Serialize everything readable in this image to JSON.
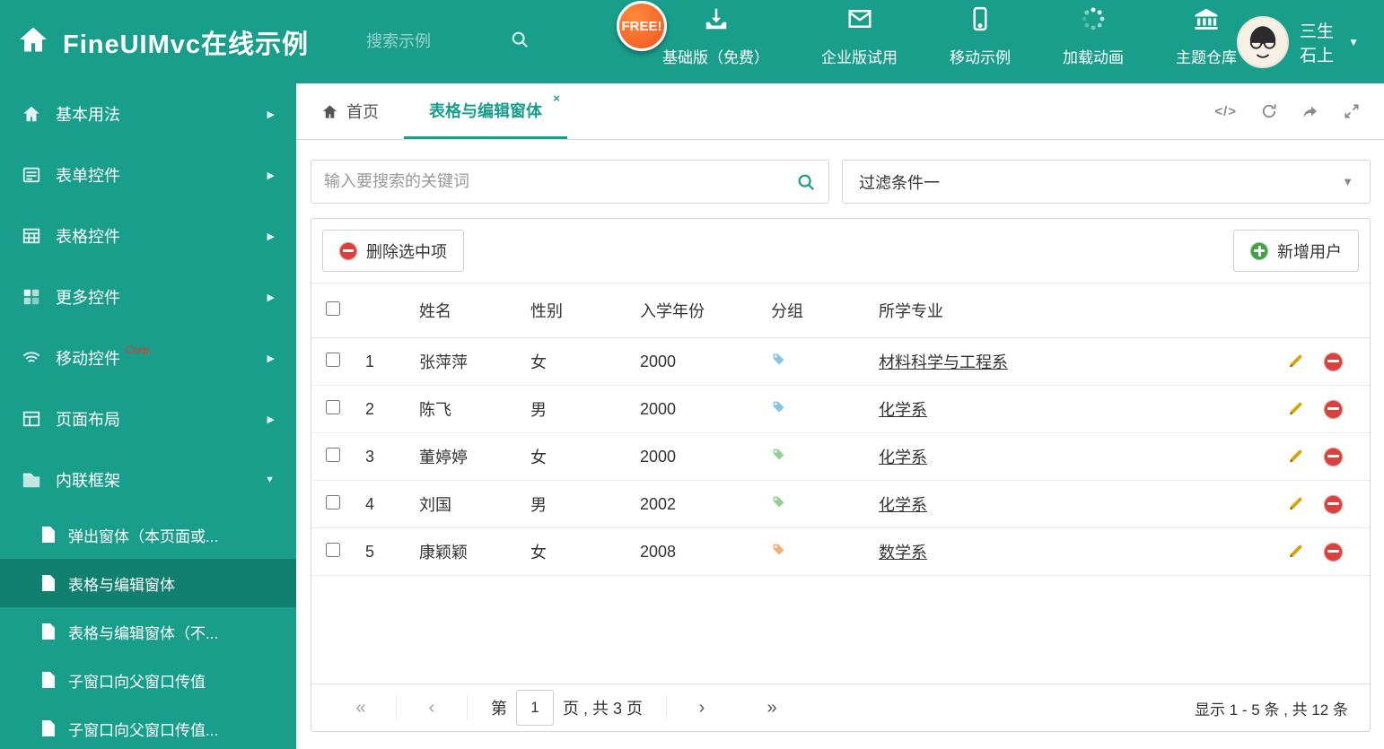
{
  "header": {
    "title": "FineUIMvc在线示例",
    "search_placeholder": "搜索示例",
    "free_badge": "FREE!",
    "nav": [
      {
        "label": "基础版（免费）",
        "icon": "download-icon"
      },
      {
        "label": "企业版试用",
        "icon": "envelope-icon"
      },
      {
        "label": "移动示例",
        "icon": "mobile-icon"
      },
      {
        "label": "加载动画",
        "icon": "spinner-icon"
      },
      {
        "label": "主题仓库",
        "icon": "bank-icon"
      }
    ],
    "user": {
      "name": "三生石上"
    }
  },
  "sidebar": {
    "items": [
      {
        "label": "基本用法",
        "icon": "home-icon"
      },
      {
        "label": "表单控件",
        "icon": "form-icon"
      },
      {
        "label": "表格控件",
        "icon": "table-icon"
      },
      {
        "label": "更多控件",
        "icon": "widgets-icon"
      },
      {
        "label": "移动控件",
        "badge": "Corp.",
        "icon": "mobile-icon"
      },
      {
        "label": "页面布局",
        "icon": "layout-icon"
      },
      {
        "label": "内联框架",
        "icon": "frame-icon",
        "expanded": true
      }
    ],
    "subitems": [
      {
        "label": "弹出窗体（本页面或..."
      },
      {
        "label": "表格与编辑窗体",
        "active": true
      },
      {
        "label": "表格与编辑窗体（不..."
      },
      {
        "label": "子窗口向父窗口传值"
      },
      {
        "label": "子窗口向父窗口传值..."
      }
    ]
  },
  "tabs": [
    {
      "label": "首页",
      "icon": "home-icon"
    },
    {
      "label": "表格与编辑窗体",
      "active": true,
      "closable": true
    }
  ],
  "content": {
    "search_placeholder": "输入要搜索的关键词",
    "filter_value": "过滤条件一",
    "toolbar": {
      "delete_label": "删除选中项",
      "add_label": "新增用户"
    },
    "table": {
      "columns": [
        "姓名",
        "性别",
        "入学年份",
        "分组",
        "所学专业"
      ],
      "rows": [
        {
          "index": 1,
          "name": "张萍萍",
          "gender": "女",
          "year": "2000",
          "tag_color": "#85C3E8",
          "major": "材料科学与工程系"
        },
        {
          "index": 2,
          "name": "陈飞",
          "gender": "男",
          "year": "2000",
          "tag_color": "#85C3E8",
          "major": "化学系"
        },
        {
          "index": 3,
          "name": "董婷婷",
          "gender": "女",
          "year": "2000",
          "tag_color": "#97CF97",
          "major": "化学系"
        },
        {
          "index": 4,
          "name": "刘国",
          "gender": "男",
          "year": "2002",
          "tag_color": "#97CF97",
          "major": "化学系"
        },
        {
          "index": 5,
          "name": "康颖颖",
          "gender": "女",
          "year": "2008",
          "tag_color": "#F2B077",
          "major": "数学系"
        }
      ]
    },
    "pagination": {
      "prefix": "第",
      "current_page": "1",
      "suffix": "页 , 共 3 页",
      "summary": "显示 1 - 5 条 , 共 12 条"
    }
  },
  "icons": {
    "chevron_right": "▶",
    "chevron_down": "▼",
    "caret_down": "▼",
    "close": "×",
    "code": "</>",
    "pg_first": "«",
    "pg_prev": "‹",
    "pg_next": "›",
    "pg_last": "»"
  },
  "colors": {
    "teal": "#1A9E8C",
    "teal_dark": "#11806E",
    "badge_orange": "#F0541E",
    "danger_red": "#D9413D",
    "success_green": "#43A047",
    "pencil_gold": "#D9A404",
    "corp_red": "#FF2D1F"
  }
}
